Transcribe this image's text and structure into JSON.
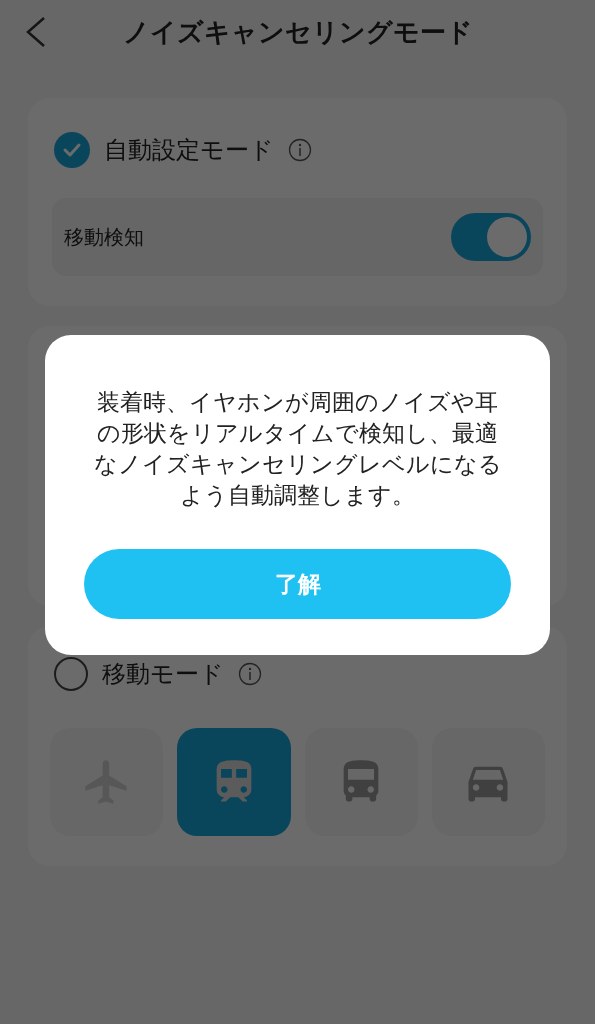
{
  "header": {
    "title": "ノイズキャンセリングモード"
  },
  "auto_mode": {
    "label": "自動設定モード",
    "checked": true,
    "option": {
      "label": "移動検知",
      "on": true
    }
  },
  "travel_mode": {
    "label": "移動モード",
    "checked": false,
    "vehicles": [
      {
        "kind": "airplane",
        "selected": false
      },
      {
        "kind": "train",
        "selected": true
      },
      {
        "kind": "bus",
        "selected": false
      },
      {
        "kind": "car",
        "selected": false
      }
    ]
  },
  "dialog": {
    "message": "装着時、イヤホンが周囲のノイズや耳の形状をリアルタイムで検知し、最適なノイズキャンセリングレベルになるよう自動調整します。",
    "button": "了解"
  }
}
